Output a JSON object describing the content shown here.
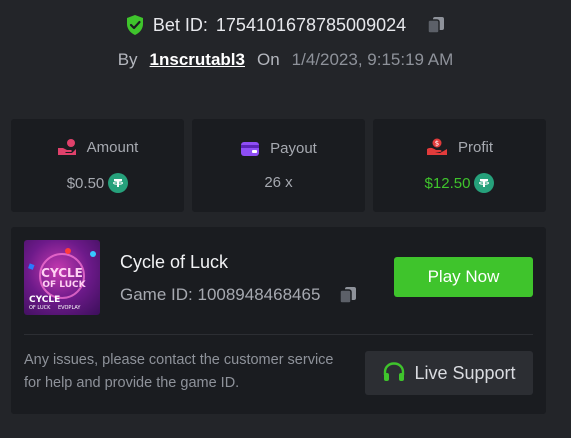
{
  "bet": {
    "label": "Bet ID:",
    "id": "1754101678785009024",
    "by_label": "By",
    "user": "1nscrutabl3",
    "on_label": "On",
    "date": "1/4/2023, 9:15:19 AM"
  },
  "stats": [
    {
      "label": "Amount",
      "value": "$0.50",
      "icon": "hand-coin-icon"
    },
    {
      "label": "Payout",
      "value": "26 x",
      "icon": "wallet-card-icon"
    },
    {
      "label": "Profit",
      "value": "$12.50",
      "icon": "hand-profit-icon"
    }
  ],
  "game": {
    "title": "Cycle of Luck",
    "id_label": "Game ID:",
    "id": "1008948468465",
    "play_label": "Play Now",
    "thumb_line1": "CYCLE",
    "thumb_line2": "OF LUCK",
    "thumb_sub1": "CYCLE",
    "thumb_sub2": "OF LUCK",
    "thumb_brand": "EVOPLAY"
  },
  "support": {
    "message": "Any issues, please contact the customer service for help and provide the game ID.",
    "button_label": "Live Support"
  },
  "colors": {
    "background": "#232529",
    "card": "#1a1c20",
    "accent_green": "#3fc42c",
    "tether": "#26a17b",
    "amount_icon": "#e0416b",
    "payout_icon": "#8e4ef5",
    "profit_icon": "#e23b3b"
  }
}
